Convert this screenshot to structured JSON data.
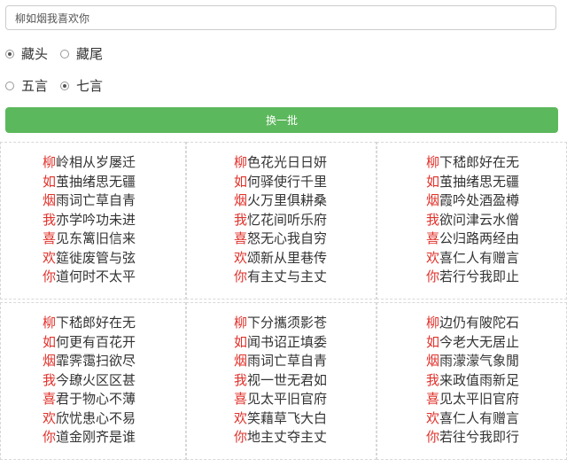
{
  "input": {
    "value": "柳如烟我喜欢你"
  },
  "options": {
    "position": [
      {
        "label": "藏头",
        "checked": true
      },
      {
        "label": "藏尾",
        "checked": false
      }
    ],
    "length": [
      {
        "label": "五言",
        "checked": false
      },
      {
        "label": "七言",
        "checked": true
      }
    ]
  },
  "button": {
    "label": "换一批"
  },
  "colors": {
    "accent": "#e0322b",
    "button": "#5cb85c"
  },
  "poems": [
    [
      {
        "first": "柳",
        "rest": "岭相从岁屡迁"
      },
      {
        "first": "如",
        "rest": "茧抽绪思无疆"
      },
      {
        "first": "烟",
        "rest": "雨词亡草自青"
      },
      {
        "first": "我",
        "rest": "亦学吟功未进"
      },
      {
        "first": "喜",
        "rest": "见东篱旧信来"
      },
      {
        "first": "欢",
        "rest": "筵徙废管与弦"
      },
      {
        "first": "你",
        "rest": "道何时不太平"
      }
    ],
    [
      {
        "first": "柳",
        "rest": "色花光日日妍"
      },
      {
        "first": "如",
        "rest": "何驿使行千里"
      },
      {
        "first": "烟",
        "rest": "火万里俱耕桑"
      },
      {
        "first": "我",
        "rest": "忆花间听乐府"
      },
      {
        "first": "喜",
        "rest": "怒无心我自穷"
      },
      {
        "first": "欢",
        "rest": "颂新从里巷传"
      },
      {
        "first": "你",
        "rest": "有主丈与主丈"
      }
    ],
    [
      {
        "first": "柳",
        "rest": "下嵇郎好在无"
      },
      {
        "first": "如",
        "rest": "茧抽绪思无疆"
      },
      {
        "first": "烟",
        "rest": "霞吟处酒盈樽"
      },
      {
        "first": "我",
        "rest": "欲问津云水僧"
      },
      {
        "first": "喜",
        "rest": "公归路两经由"
      },
      {
        "first": "欢",
        "rest": "喜仁人有赠言"
      },
      {
        "first": "你",
        "rest": "若行兮我即止"
      }
    ],
    [
      {
        "first": "柳",
        "rest": "下嵇郎好在无"
      },
      {
        "first": "如",
        "rest": "何更有百花开"
      },
      {
        "first": "烟",
        "rest": "霏霁霭扫欲尽"
      },
      {
        "first": "我",
        "rest": "今镽火区区甚"
      },
      {
        "first": "喜",
        "rest": "君于物心不薄"
      },
      {
        "first": "欢",
        "rest": "欣忧患心不易"
      },
      {
        "first": "你",
        "rest": "道金刚齐是谁"
      }
    ],
    [
      {
        "first": "柳",
        "rest": "下分攜须影苍"
      },
      {
        "first": "如",
        "rest": "闻书诏正填委"
      },
      {
        "first": "烟",
        "rest": "雨词亡草自青"
      },
      {
        "first": "我",
        "rest": "视一世无君如"
      },
      {
        "first": "喜",
        "rest": "见太平旧官府"
      },
      {
        "first": "欢",
        "rest": "笑藉草飞大白"
      },
      {
        "first": "你",
        "rest": "地主丈夺主丈"
      }
    ],
    [
      {
        "first": "柳",
        "rest": "边仍有陂陀石"
      },
      {
        "first": "如",
        "rest": "今老大无居止"
      },
      {
        "first": "烟",
        "rest": "雨濛濛气象閒"
      },
      {
        "first": "我",
        "rest": "来政值雨新足"
      },
      {
        "first": "喜",
        "rest": "见太平旧官府"
      },
      {
        "first": "欢",
        "rest": "喜仁人有赠言"
      },
      {
        "first": "你",
        "rest": "若往兮我即行"
      }
    ]
  ]
}
